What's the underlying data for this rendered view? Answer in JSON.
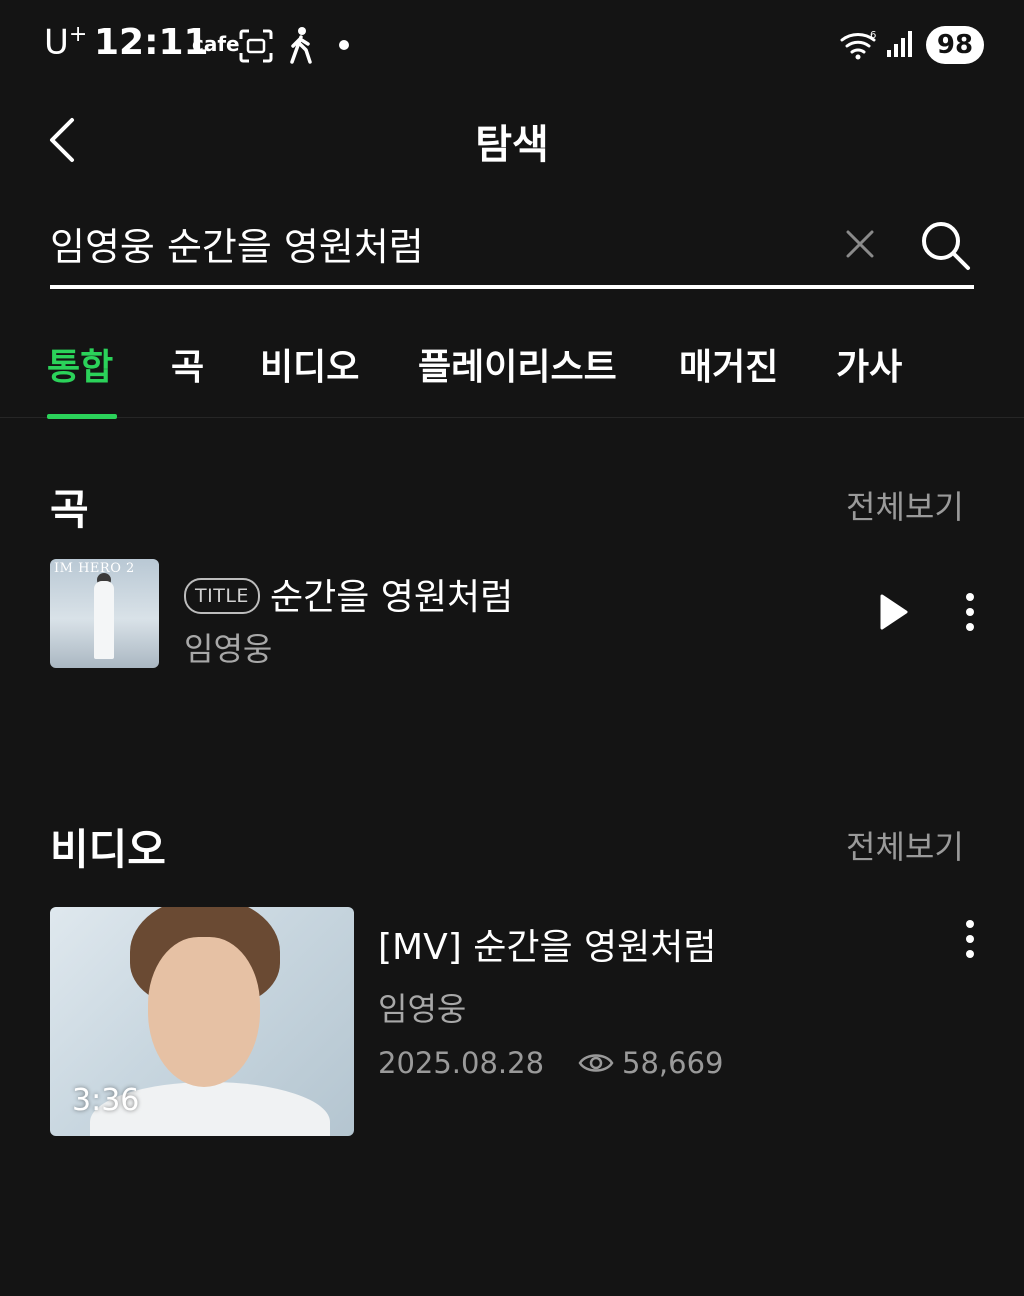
{
  "status_bar": {
    "carrier": "U",
    "carrier_sup": "+",
    "time": "12:11",
    "app_label": "cafe",
    "battery": "98"
  },
  "header": {
    "title": "탐색"
  },
  "search": {
    "query": "임영웅 순간을 영원처럼"
  },
  "tabs": [
    {
      "label": "통합",
      "active": true
    },
    {
      "label": "곡"
    },
    {
      "label": "비디오"
    },
    {
      "label": "플레이리스트"
    },
    {
      "label": "매거진"
    },
    {
      "label": "가사"
    }
  ],
  "songs_section": {
    "title": "곡",
    "see_all": "전체보기",
    "items": [
      {
        "album_text": "IM HERO 2",
        "badge": "TITLE",
        "title": "순간을 영원처럼",
        "artist": "임영웅"
      }
    ]
  },
  "video_section": {
    "title": "비디오",
    "see_all": "전체보기",
    "items": [
      {
        "title": "[MV] 순간을 영원처럼",
        "artist": "임영웅",
        "date": "2025.08.28",
        "views": "58,669",
        "duration": "3:36"
      }
    ]
  },
  "colors": {
    "background": "#141414",
    "accent": "#2bd25a",
    "secondary_text": "#a8a8a8"
  }
}
